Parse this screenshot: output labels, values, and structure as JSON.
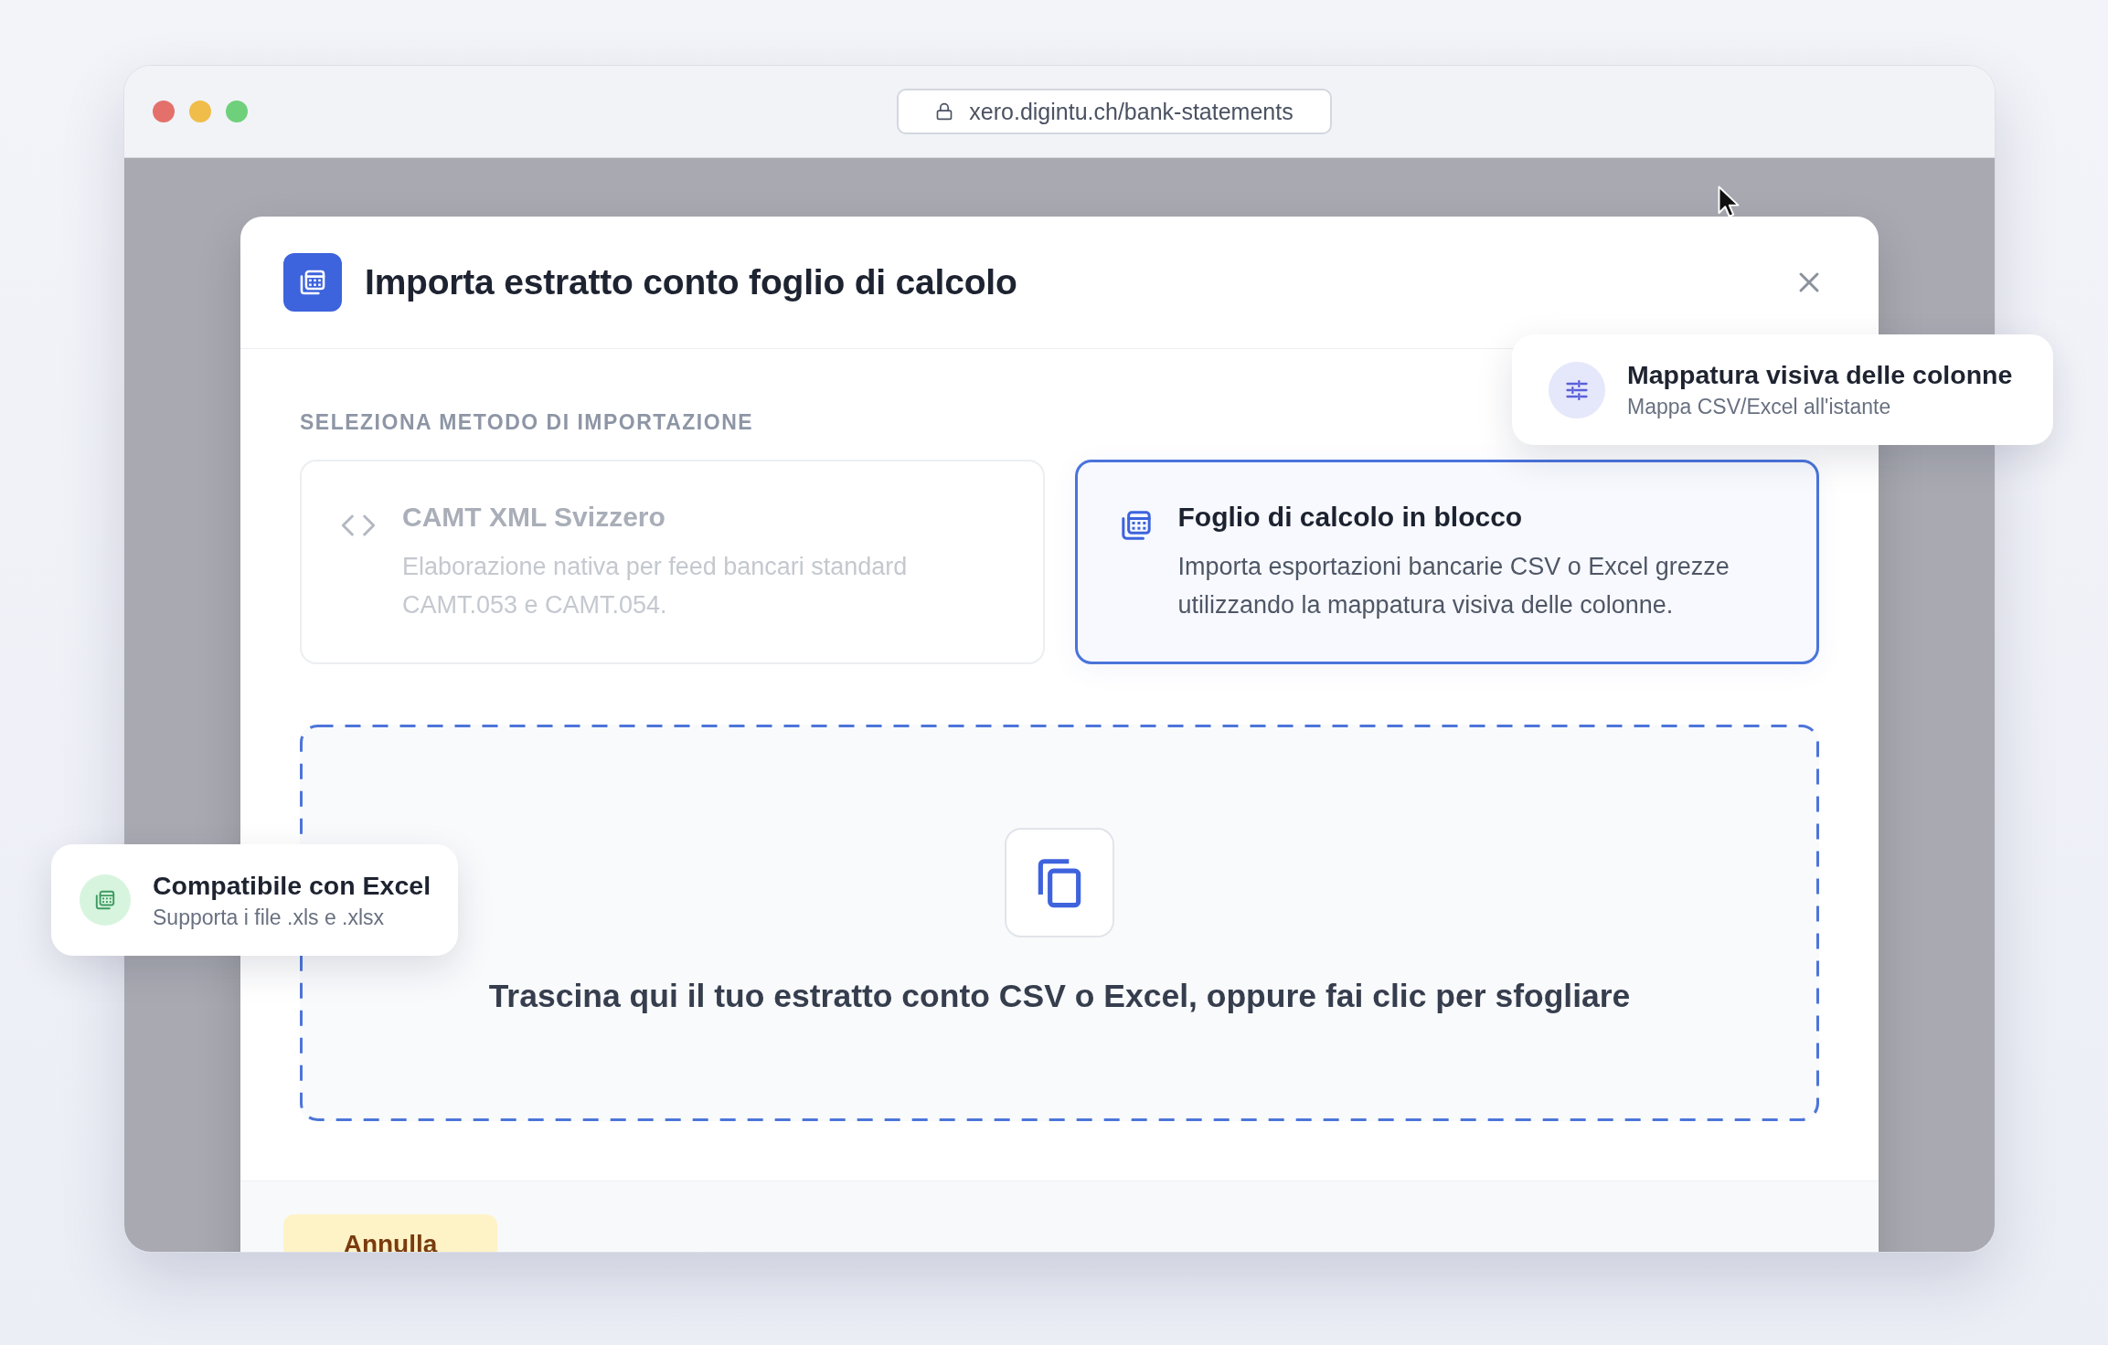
{
  "browser": {
    "url": "xero.digintu.ch/bank-statements"
  },
  "modal": {
    "title": "Importa estratto conto foglio di calcolo",
    "section_label": "SELEZIONA METODO DI IMPORTAZIONE",
    "methods": [
      {
        "kind": "xml",
        "title": "CAMT XML Svizzero",
        "description": "Elaborazione nativa per feed bancari standard CAMT.053 e CAMT.054.",
        "selected": false
      },
      {
        "kind": "spreadsheet",
        "title": "Foglio di calcolo in blocco",
        "description": "Importa esportazioni bancarie CSV o Excel grezze utilizzando la mappatura visiva delle colonne.",
        "selected": true
      }
    ],
    "dropzone": {
      "text": "Trascina qui il tuo estratto conto CSV o Excel, oppure fai clic per sfogliare"
    },
    "footer": {
      "buttons": [
        {
          "label": "Annulla"
        }
      ]
    }
  },
  "callouts": [
    {
      "kind": "mapping",
      "title": "Mappatura visiva delle colonne",
      "subtitle": "Mappa CSV/Excel all'istante"
    },
    {
      "kind": "excel",
      "title": "Compatibile con Excel",
      "subtitle": "Supporta i file .xls e .xlsx"
    }
  ]
}
